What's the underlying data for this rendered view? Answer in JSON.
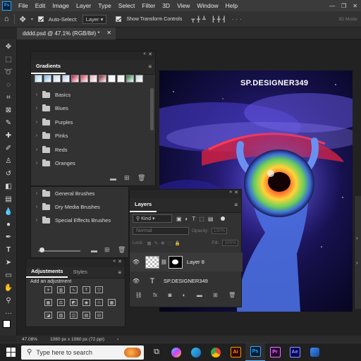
{
  "app": {
    "logo": "Ps"
  },
  "menu": [
    "File",
    "Edit",
    "Image",
    "Layer",
    "Type",
    "Select",
    "Filter",
    "3D",
    "View",
    "Window",
    "Help"
  ],
  "window_controls": {
    "minimize": "—",
    "restore": "❐",
    "close": "✕"
  },
  "options_bar": {
    "auto_select_label": "Auto-Select:",
    "auto_select_target": "Layer",
    "show_transform_label": "Show Transform Controls",
    "mode_3d": "3D Mode:"
  },
  "document_tab": {
    "title": "dddd.psd @ 47.1% (RGB/8#) *",
    "close": "✕"
  },
  "canvas": {
    "artwork_text": "SP.DESIGNER349"
  },
  "gradients_panel": {
    "tab": "Gradients",
    "folders": [
      "Basics",
      "Blues",
      "Purples",
      "Pinks",
      "Reds",
      "Oranges"
    ],
    "swatch_colors": [
      "#9fd4f0",
      "#7bb7e8",
      "#c7d9ef",
      "#b8c8f0",
      "#c2183a",
      "#d43a5a",
      "#e3b0bd",
      "#8c1a2a",
      "#f2f2f2",
      "#e8e8e8",
      "#1f7a3a",
      "#bfcfd9"
    ]
  },
  "brushes_panel": {
    "folders": [
      "General Brushes",
      "Dry Media Brushes",
      "Special Effects Brushes"
    ]
  },
  "adjustments_panel": {
    "tabs": [
      "Adjustments",
      "Styles"
    ],
    "add_label": "Add an adjustment",
    "icons": [
      "brightness-contrast",
      "levels",
      "curves",
      "exposure",
      "vibrance",
      "hue-saturation",
      "color-balance",
      "black-white",
      "photo-filter",
      "channel-mixer",
      "color-lookup",
      "invert",
      "posterize",
      "threshold",
      "gradient-map",
      "selective-color"
    ]
  },
  "layers_panel": {
    "tab": "Layers",
    "kind_filter": "Kind",
    "blend_mode": "Normal",
    "opacity_label": "Opacity:",
    "opacity_value": "100%",
    "lock_label": "Lock:",
    "fill_label": "Fill:",
    "fill_value": "100%",
    "layers": [
      {
        "name": "Layer 8",
        "type": "image"
      },
      {
        "name": "SP.DESIGNER349",
        "type": "text",
        "thumb": "T"
      }
    ]
  },
  "status_bar": {
    "zoom": "47.08%",
    "doc_info": "1080 px x 1080 px (72 ppi)"
  },
  "taskbar": {
    "search_placeholder": "Type here to search",
    "apps": [
      {
        "label": "Ai",
        "bg": "#330000",
        "fg": "#ff9a00"
      },
      {
        "label": "Ps",
        "bg": "#001e36",
        "fg": "#31a8ff"
      },
      {
        "label": "Pr",
        "bg": "#2a0033",
        "fg": "#e77cff"
      },
      {
        "label": "Ae",
        "bg": "#00005b",
        "fg": "#9999ff"
      }
    ]
  }
}
